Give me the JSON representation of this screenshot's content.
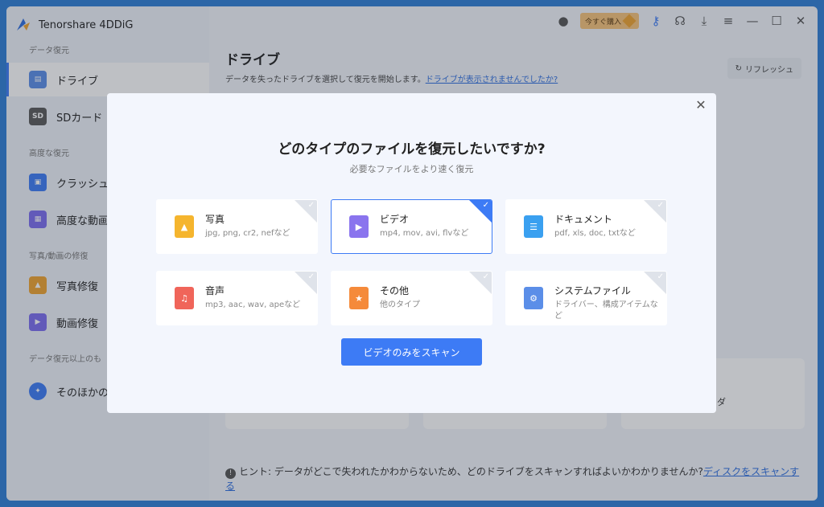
{
  "app": {
    "title": "Tenorshare 4DDiG"
  },
  "titlebar": {
    "buy_label": "今すぐ購入"
  },
  "sidebar": {
    "sections": [
      {
        "label": "データ復元"
      },
      {
        "label": "高度な復元"
      },
      {
        "label": "写真/動画の修復"
      },
      {
        "label": "データ復元以上のも"
      }
    ],
    "items": [
      {
        "label": "ドライブ",
        "icon": "drive-icon",
        "color": "#3d7bf5"
      },
      {
        "label": "SDカード",
        "icon": "sd-card-icon",
        "color": "#6b6b6b"
      },
      {
        "label": "クラッシュ",
        "icon": "crash-monitor-icon",
        "color": "#3d7bf5"
      },
      {
        "label": "高度な動画",
        "icon": "video-film-icon",
        "color": "#7c6df0"
      },
      {
        "label": "写真修復",
        "icon": "photo-repair-icon",
        "color": "#f0a430"
      },
      {
        "label": "動画修復",
        "icon": "video-repair-icon",
        "color": "#7c6df0"
      },
      {
        "label": "そのほかの",
        "icon": "compass-icon",
        "color": "#3d7bf5"
      }
    ]
  },
  "main": {
    "title": "ドライブ",
    "subtitle": "データを失ったドライブを選択して復元を開始します。",
    "subtitle_link": "ドライブが表示されませんでしたか?",
    "refresh_label": "リフレッシュ",
    "bg_card_text": "ンダ",
    "hint_label": "ヒント:",
    "hint_text": "データがどこで失われたかわからないため、どのドライブをスキャンすればよいかわかりませんか?",
    "hint_link": "ディスクをスキャンする"
  },
  "modal": {
    "title": "どのタイプのファイルを復元したいですか?",
    "subtitle": "必要なファイルをより速く復元",
    "scan_button": "ビデオのみをスキャン",
    "types": [
      {
        "name": "写真",
        "ext": "jpg, png, cr2, nefなど",
        "icon": "photo-file-icon",
        "color": "#f5b52e",
        "selected": false
      },
      {
        "name": "ビデオ",
        "ext": "mp4, mov, avi, flvなど",
        "icon": "video-file-icon",
        "color": "#8a74ee",
        "selected": true
      },
      {
        "name": "ドキュメント",
        "ext": "pdf, xls, doc, txtなど",
        "icon": "document-file-icon",
        "color": "#3aa0f0",
        "selected": false
      },
      {
        "name": "音声",
        "ext": "mp3, aac, wav, apeなど",
        "icon": "audio-file-icon",
        "color": "#f0655a",
        "selected": false
      },
      {
        "name": "その他",
        "ext": "他のタイプ",
        "icon": "other-file-icon",
        "color": "#f58a3a",
        "selected": false
      },
      {
        "name": "システムファイル",
        "ext": "ドライバー、構成アイテムなど",
        "icon": "system-file-icon",
        "color": "#5b8ee8",
        "selected": false
      }
    ]
  }
}
